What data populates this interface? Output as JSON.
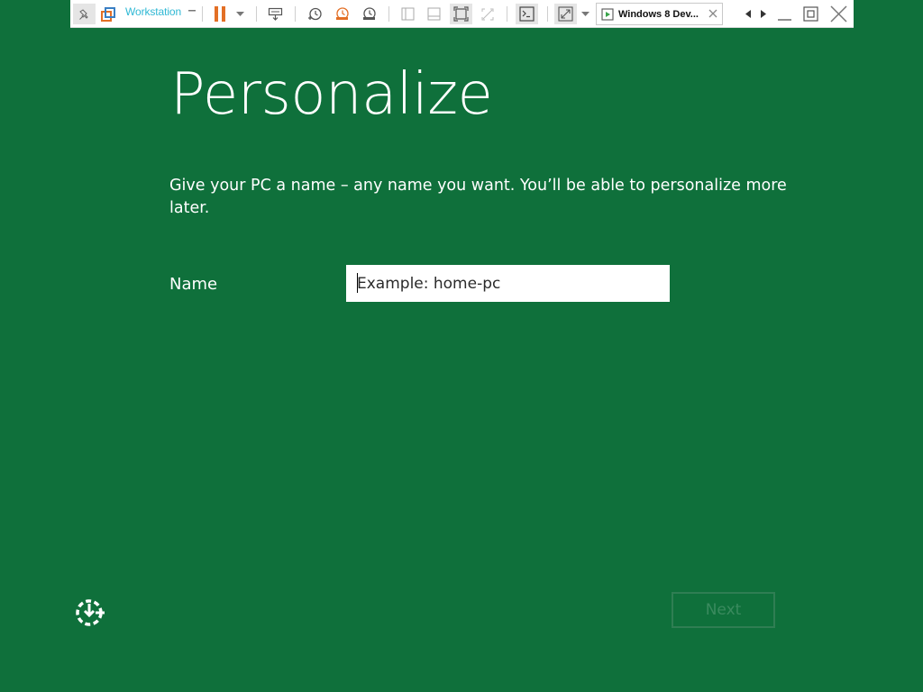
{
  "toolbar": {
    "product_label": "Workstation",
    "tab_title": "Windows 8 Dev..."
  },
  "oobe": {
    "title": "Personalize",
    "description": "Give your PC a name – any name you want. You’ll be able to personalize more later.",
    "name_label": "Name",
    "name_placeholder": "Example: home-pc",
    "next_label": "Next"
  },
  "colors": {
    "background": "#0f703b",
    "accent_orange": "#e36f25",
    "toolbar_link": "#2fb8d4"
  },
  "icons": [
    "pin-icon",
    "vmware-logo-icon",
    "pause-icon",
    "send-keys-icon",
    "snapshot-icon",
    "revert-snapshot-icon",
    "snapshot-manager-icon",
    "console-icon",
    "fullscreen-icon",
    "ease-of-access-icon"
  ]
}
